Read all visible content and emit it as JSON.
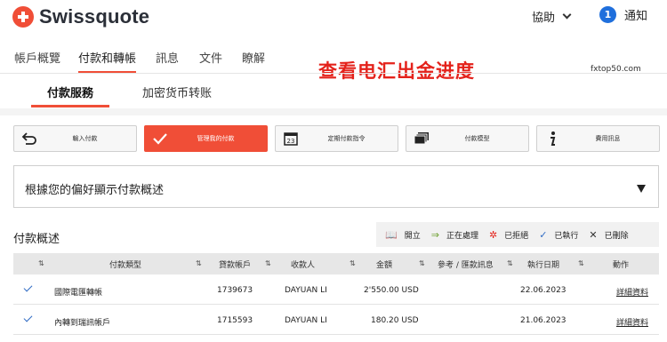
{
  "header": {
    "brand": "Swissquote",
    "help_label": "協助",
    "notification_count": "1",
    "notification_label": "通知"
  },
  "nav": {
    "tabs": [
      {
        "label": "帳戶概覽",
        "active": false
      },
      {
        "label": "付款和轉帳",
        "active": true
      },
      {
        "label": "訊息",
        "active": false
      },
      {
        "label": "文件",
        "active": false
      },
      {
        "label": "瞭解",
        "active": false
      }
    ]
  },
  "annotation": {
    "banner": "查看电汇出金进度",
    "watermark": "fxtop50.com"
  },
  "subtabs": [
    {
      "label": "付款服務",
      "active": true
    },
    {
      "label": "加密货币转账",
      "active": false
    }
  ],
  "actions": [
    {
      "label": "輸入付款",
      "icon": "back-arrow-icon",
      "primary": false
    },
    {
      "label": "管理我的付款",
      "icon": "checkmark-icon",
      "primary": true
    },
    {
      "label": "定期付款指令",
      "icon": "calendar-icon",
      "primary": false
    },
    {
      "label": "付款模型",
      "icon": "stacked-cards-icon",
      "primary": false
    },
    {
      "label": "費用訊息",
      "icon": "info-icon",
      "primary": false
    }
  ],
  "preferences": {
    "label": "根據您的偏好顯示付款概述"
  },
  "overview": {
    "title": "付款概述",
    "legend": [
      {
        "label": "開立",
        "icon": "open-book-icon"
      },
      {
        "label": "正在處理",
        "icon": "arrow-right-icon"
      },
      {
        "label": "已拒絕",
        "icon": "rejected-star-icon"
      },
      {
        "label": "已執行",
        "icon": "check-icon"
      },
      {
        "label": "已刪除",
        "icon": "x-icon"
      }
    ],
    "columns": [
      "付款類型",
      "貸款帳戶",
      "收款人",
      "金額",
      "參考 / 匯款訊息",
      "執行日期",
      "動作"
    ],
    "rows": [
      {
        "type": "國際電匯轉帳",
        "account": "1739673",
        "payee": "DAYUAN LI",
        "amount": "2'550.00 USD",
        "reference": "",
        "date": "22.06.2023",
        "action": "詳細資料"
      },
      {
        "type": "內轉到瑞訊帳戶",
        "account": "1715593",
        "payee": "DAYUAN LI",
        "amount": "180.20 USD",
        "reference": "",
        "date": "21.06.2023",
        "action": "詳細資料"
      }
    ]
  },
  "colors": {
    "accent": "#f04e37",
    "banner": "#e4221b",
    "badge": "#1f6fdc"
  }
}
